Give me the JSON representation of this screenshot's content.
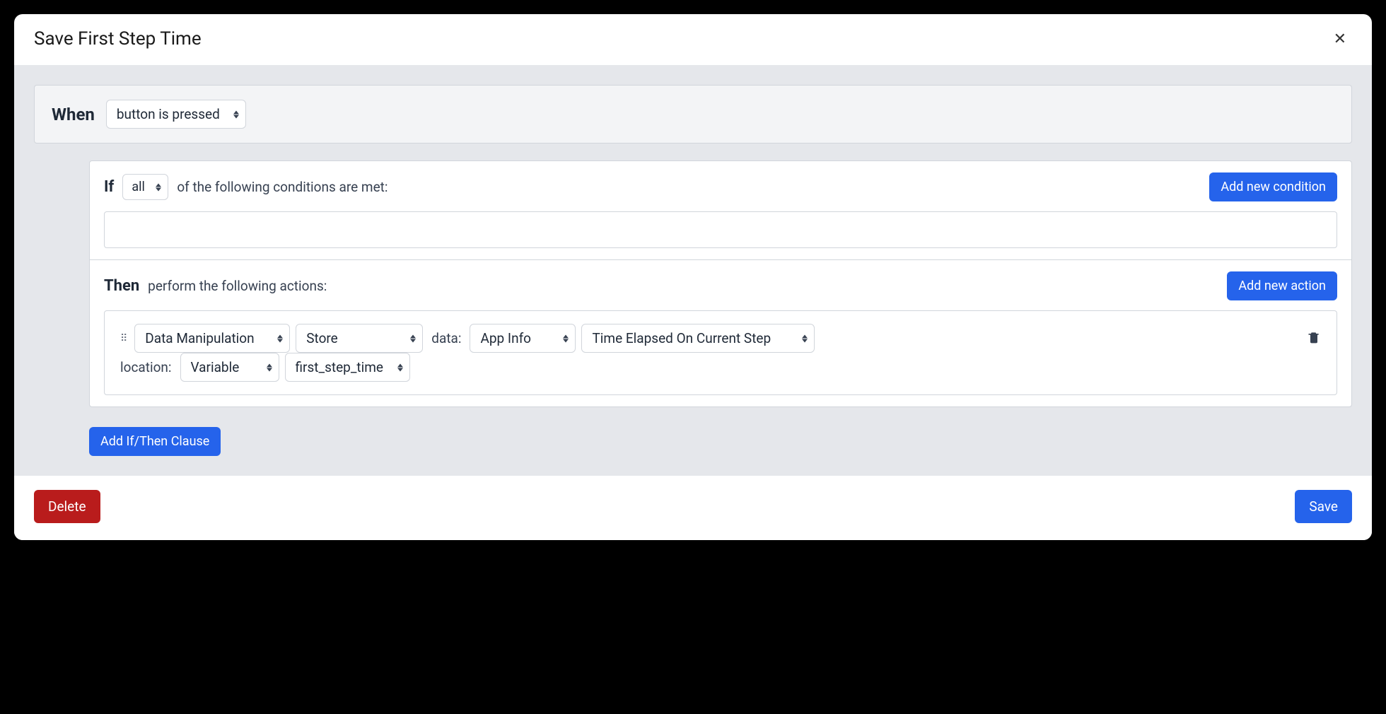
{
  "modal": {
    "title": "Save First Step Time"
  },
  "when": {
    "label": "When",
    "trigger": "button is pressed"
  },
  "if": {
    "label": "If",
    "quantifier": "all",
    "suffix": "of the following conditions are met:",
    "add_button": "Add new condition"
  },
  "then": {
    "label": "Then",
    "suffix": "perform the following actions:",
    "add_button": "Add new action"
  },
  "action": {
    "category": "Data Manipulation",
    "operation": "Store",
    "data_label": "data:",
    "data_source": "App Info",
    "data_field": "Time Elapsed On Current Step",
    "location_label": "location:",
    "location_type": "Variable",
    "location_value": "first_step_time"
  },
  "buttons": {
    "add_clause": "Add If/Then Clause",
    "delete": "Delete",
    "save": "Save"
  }
}
